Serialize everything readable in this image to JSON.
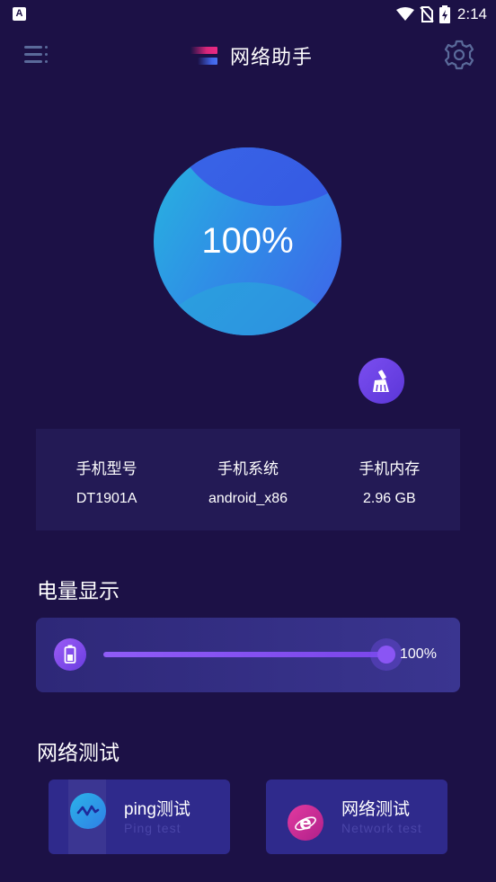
{
  "status_bar": {
    "time": "2:14",
    "notification_glyph": "A"
  },
  "header": {
    "title": "网络助手"
  },
  "meter": {
    "percent_text": "100%",
    "value_percent": 100
  },
  "device_info": {
    "items": [
      {
        "label": "手机型号",
        "value": "DT1901A"
      },
      {
        "label": "手机系统",
        "value": "android_x86"
      },
      {
        "label": "手机内存",
        "value": "2.96 GB"
      }
    ]
  },
  "battery": {
    "section_title": "电量显示",
    "percent_text": "100%",
    "level_percent": 100
  },
  "network_test": {
    "section_title": "网络测试",
    "cards": [
      {
        "title": "ping测试",
        "subtitle": "Ping test",
        "icon": "pulse-wave-icon"
      },
      {
        "title": "网络测试",
        "subtitle": "Network test",
        "icon": "browser-e-icon"
      }
    ]
  },
  "colors": {
    "background": "#1c1146",
    "card": "#231a55",
    "accent": "#8a55f4",
    "orb_blue": "#2f8ee6"
  }
}
